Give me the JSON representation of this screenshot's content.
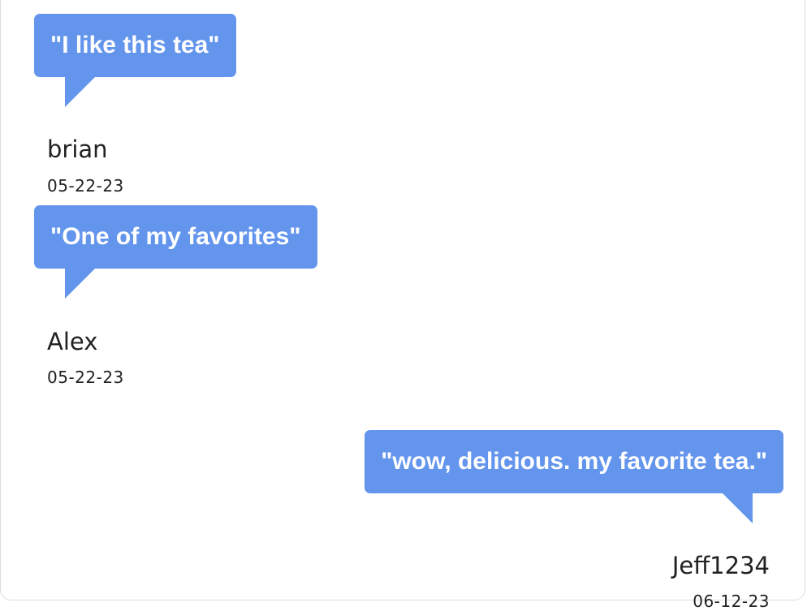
{
  "reviews": [
    {
      "comment": "\"I like this tea\"",
      "author": "brian",
      "date": "05-22-23"
    },
    {
      "comment": "\"One of my favorites\"",
      "author": "Alex",
      "date": "05-22-23"
    },
    {
      "comment": "\"wow, delicious. my favorite tea.\"",
      "author": "Jeff1234",
      "date": "06-12-23"
    }
  ],
  "colors": {
    "bubble": "#6495ed",
    "bubble_text": "#ffffff",
    "text": "#212121"
  }
}
